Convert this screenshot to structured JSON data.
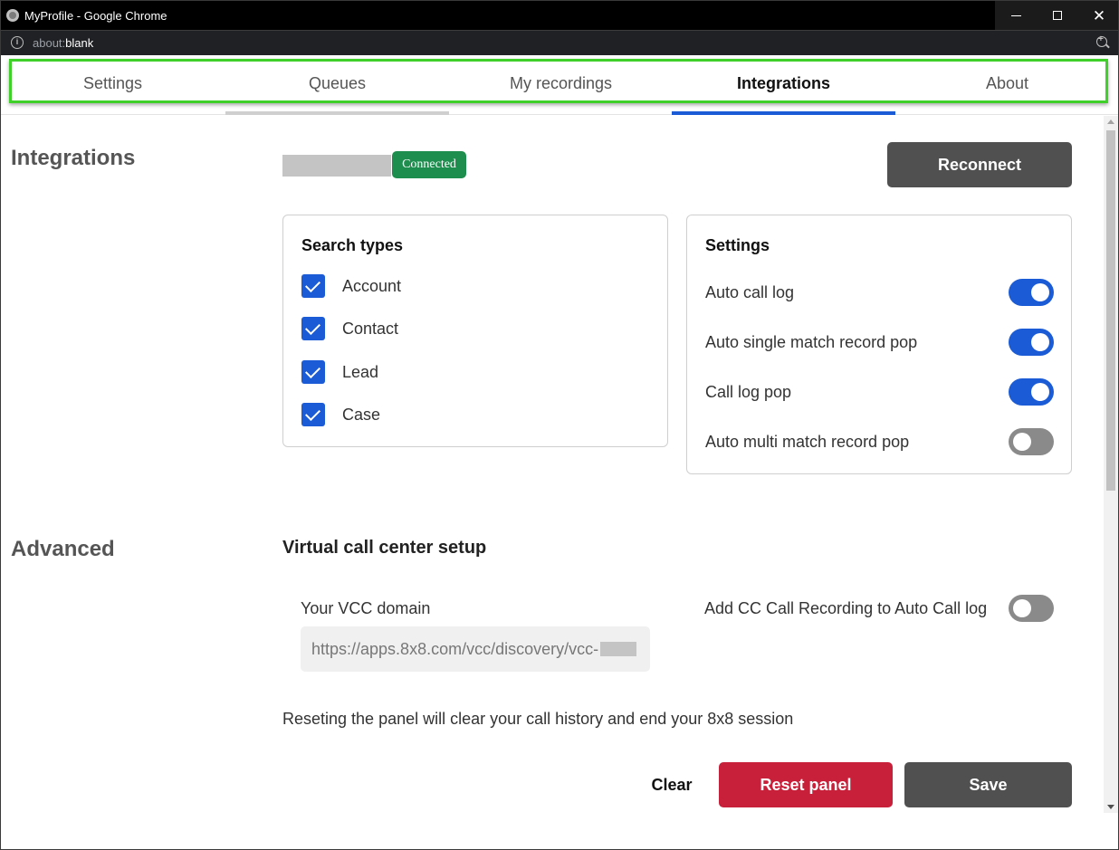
{
  "window": {
    "title": "MyProfile - Google Chrome",
    "url_scheme": "about:",
    "url_host": "blank",
    "minimize_icon": "minimize-icon",
    "maximize_icon": "maximize-icon",
    "close_icon": "close-icon",
    "close_glyph": "✕"
  },
  "tabs": [
    {
      "label": "Settings",
      "active": false
    },
    {
      "label": "Queues",
      "active": false
    },
    {
      "label": "My recordings",
      "active": false
    },
    {
      "label": "Integrations",
      "active": true
    },
    {
      "label": "About",
      "active": false
    }
  ],
  "integrations": {
    "section_title": "Integrations",
    "status_badge": "Connected",
    "reconnect_label": "Reconnect",
    "search_types": {
      "title": "Search types",
      "items": [
        {
          "label": "Account",
          "checked": true
        },
        {
          "label": "Contact",
          "checked": true
        },
        {
          "label": "Lead",
          "checked": true
        },
        {
          "label": "Case",
          "checked": true
        }
      ]
    },
    "settings": {
      "title": "Settings",
      "items": [
        {
          "label": "Auto call log",
          "on": true
        },
        {
          "label": "Auto single match record pop",
          "on": true
        },
        {
          "label": "Call log pop",
          "on": true
        },
        {
          "label": "Auto multi match record pop",
          "on": false
        }
      ]
    }
  },
  "advanced": {
    "section_title": "Advanced",
    "vcc_title": "Virtual call center setup",
    "vcc_domain_label": "Your VCC domain",
    "vcc_domain_value": "https://apps.8x8.com/vcc/discovery/vcc-",
    "cc_recording_label": "Add CC Call Recording to Auto Call log",
    "cc_recording_on": false,
    "reset_note": "Reseting the panel will clear your call history and end your 8x8 session",
    "clear_label": "Clear",
    "reset_label": "Reset panel",
    "save_label": "Save"
  },
  "colors": {
    "accent": "#1b5cd6",
    "connected": "#1e8e4e",
    "danger": "#c8203a",
    "dark_button": "#505050",
    "highlight": "#3fd12a"
  }
}
